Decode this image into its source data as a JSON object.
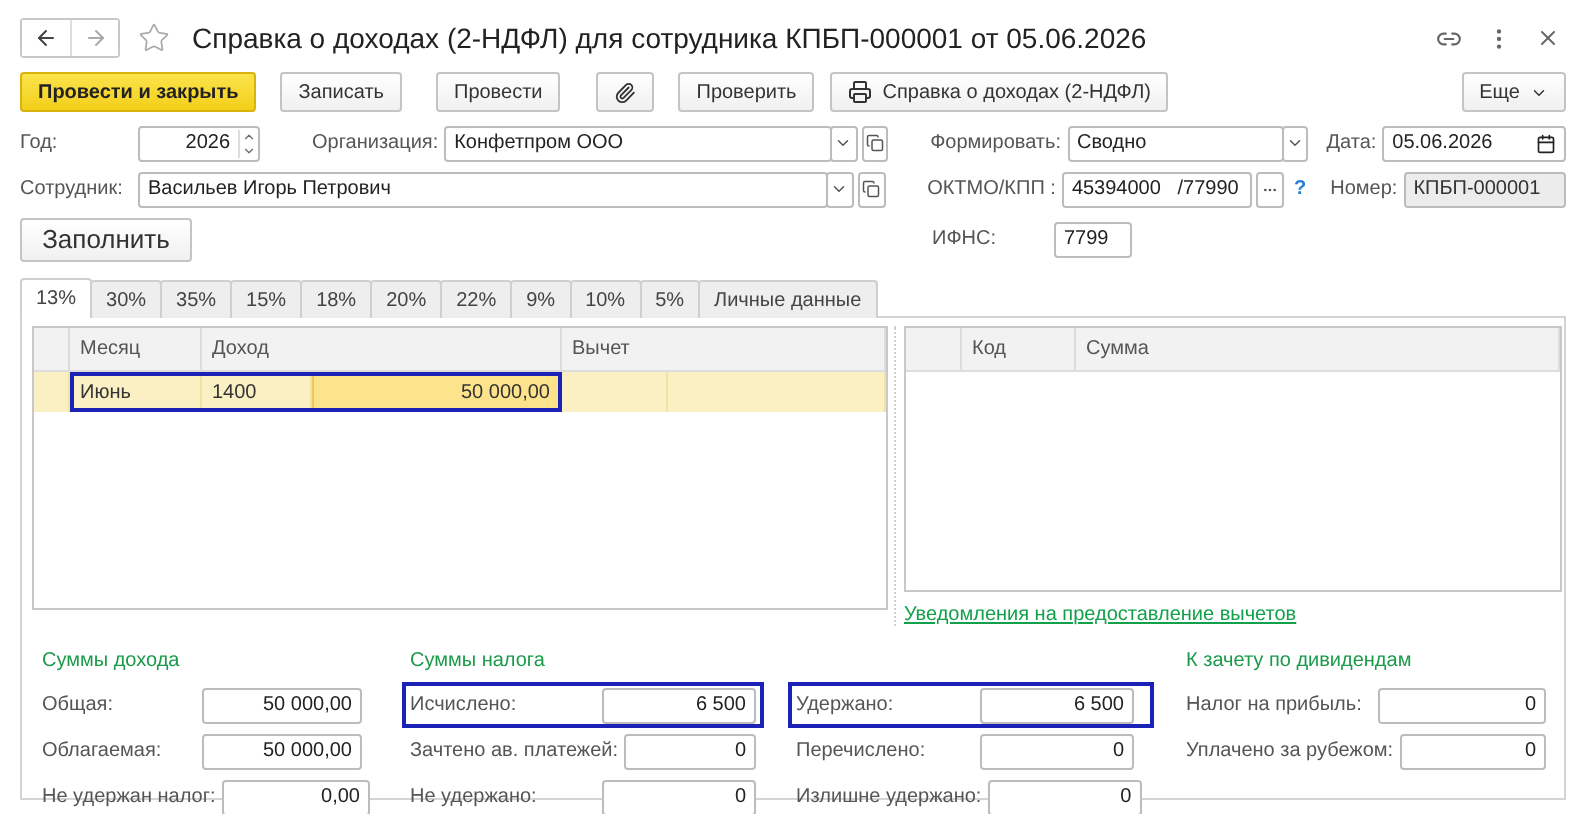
{
  "window": {
    "title": "Справка о доходах (2-НДФЛ) для сотрудника КПБП-000001 от 05.06.2026"
  },
  "toolbar": {
    "buttons": [
      {
        "label": "Провести и закрыть",
        "kind": "primary"
      },
      {
        "label": "Записать",
        "kind": "plain"
      },
      {
        "label": "Провести",
        "kind": "plain"
      },
      {
        "kind": "attach"
      },
      {
        "label": "Проверить",
        "kind": "plain"
      },
      {
        "label": "Справка о доходах (2-НДФЛ)",
        "kind": "print"
      }
    ],
    "more": "Еще"
  },
  "fields": {
    "year": {
      "label": "Год:",
      "value": "2026"
    },
    "organization": {
      "label": "Организация:",
      "value": "Конфетпром ООО"
    },
    "form_mode": {
      "label": "Формировать:",
      "value": "Сводно"
    },
    "date": {
      "label": "Дата:",
      "value": "05.06.2026"
    },
    "employee": {
      "label": "Сотрудник:",
      "value": "Васильев Игорь Петрович"
    },
    "oktmo_kpp": {
      "label": "ОКТМО/КПП :",
      "value": "45394000   /77990",
      "help": "?"
    },
    "number": {
      "label": "Номер:",
      "value": "КПБП-000001",
      "disabled": true
    },
    "ifns": {
      "label": "ИФНС:",
      "value": "7799"
    }
  },
  "fill_button": "Заполнить",
  "tabs": [
    {
      "label": "13%",
      "selected": true
    },
    {
      "label": "30%",
      "selected": false
    },
    {
      "label": "35%",
      "selected": false
    },
    {
      "label": "15%",
      "selected": false
    },
    {
      "label": "18%",
      "selected": false
    },
    {
      "label": "20%",
      "selected": false
    },
    {
      "label": "22%",
      "selected": false
    },
    {
      "label": "9%",
      "selected": false
    },
    {
      "label": "10%",
      "selected": false
    },
    {
      "label": "5%",
      "selected": false
    },
    {
      "label": "Личные данные",
      "selected": false
    }
  ],
  "income_table": {
    "columns": [
      "Месяц",
      "Доход",
      "Вычет"
    ],
    "rows": [
      {
        "month": "Июнь",
        "code": "1400",
        "amount": "50 000,00",
        "selected": true,
        "highlighted": true
      }
    ]
  },
  "deduction_table": {
    "columns": [
      "Код",
      "Сумма"
    ]
  },
  "notice_link": "Уведомления на предоставление вычетов",
  "groups": [
    {
      "title": "Суммы дохода",
      "fields": [
        {
          "label": "Общая:",
          "value": "50 000,00",
          "highlighted": false
        },
        {
          "label": "Облагаемая:",
          "value": "50 000,00",
          "highlighted": false
        },
        {
          "label": "Не удержан налог:",
          "value": "0,00",
          "highlighted": false
        }
      ]
    },
    {
      "title": "Суммы налога",
      "fields": [
        {
          "label": "Исчислено:",
          "value": "6 500",
          "highlighted": true
        },
        {
          "label": "Зачтено ав. платежей:",
          "value": "0",
          "highlighted": false
        },
        {
          "label": "Не удержано:",
          "value": "0",
          "highlighted": false
        }
      ]
    },
    {
      "fields": [
        {
          "label": "Удержано:",
          "value": "6 500",
          "highlighted": true
        },
        {
          "label": "Перечислено:",
          "value": "0",
          "highlighted": false
        },
        {
          "label": "Излишне удержано:",
          "value": "0",
          "highlighted": false
        }
      ]
    },
    {
      "title": "К зачету по дивидендам",
      "fields": [
        {
          "label": "Налог на прибыль:",
          "value": "0",
          "highlighted": false
        },
        {
          "label": "Уплачено за рубежом:",
          "value": "0",
          "highlighted": false
        }
      ]
    }
  ]
}
